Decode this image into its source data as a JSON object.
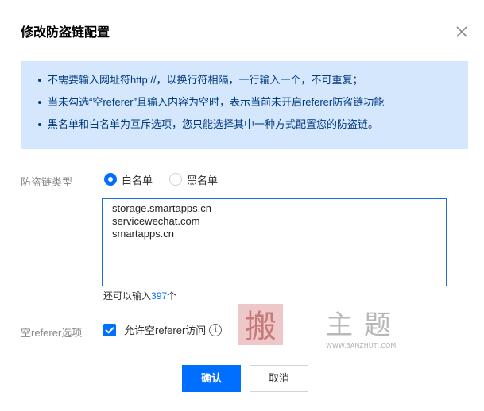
{
  "dialog": {
    "title": "修改防盗链配置",
    "close_icon": "close-icon"
  },
  "notice": {
    "items": [
      "不需要输入网址符http://，以换行符相隔，一行输入一个，不可重复；",
      "当未勾选“空referer”且输入内容为空时，表示当前未开启referer防盗链功能",
      "黑名单和白名单为互斥选项，您只能选择其中一种方式配置您的防盗链。"
    ]
  },
  "form": {
    "type_label": "防盗链类型",
    "radios": [
      {
        "label": "白名单",
        "checked": true
      },
      {
        "label": "黑名单",
        "checked": false
      }
    ],
    "domains": [
      "storage.smartapps.cn",
      "servicewechat.com",
      "smartapps.cn"
    ],
    "remain_prefix": "还可以输入",
    "remain_count": "397",
    "remain_suffix": "个",
    "empty_referer_label": "空referer选项",
    "allow_empty_label": "允许空referer访问",
    "allow_empty_checked": true,
    "info_icon": "info-icon"
  },
  "buttons": {
    "confirm": "确认",
    "cancel": "取消"
  },
  "watermark": {
    "seal_text": "搬",
    "text": "主题",
    "url": "WWW.BANZHUTI.COM"
  },
  "colors": {
    "primary": "#006eff",
    "notice_bg": "#d5e7fd",
    "notice_text": "#003b80"
  }
}
